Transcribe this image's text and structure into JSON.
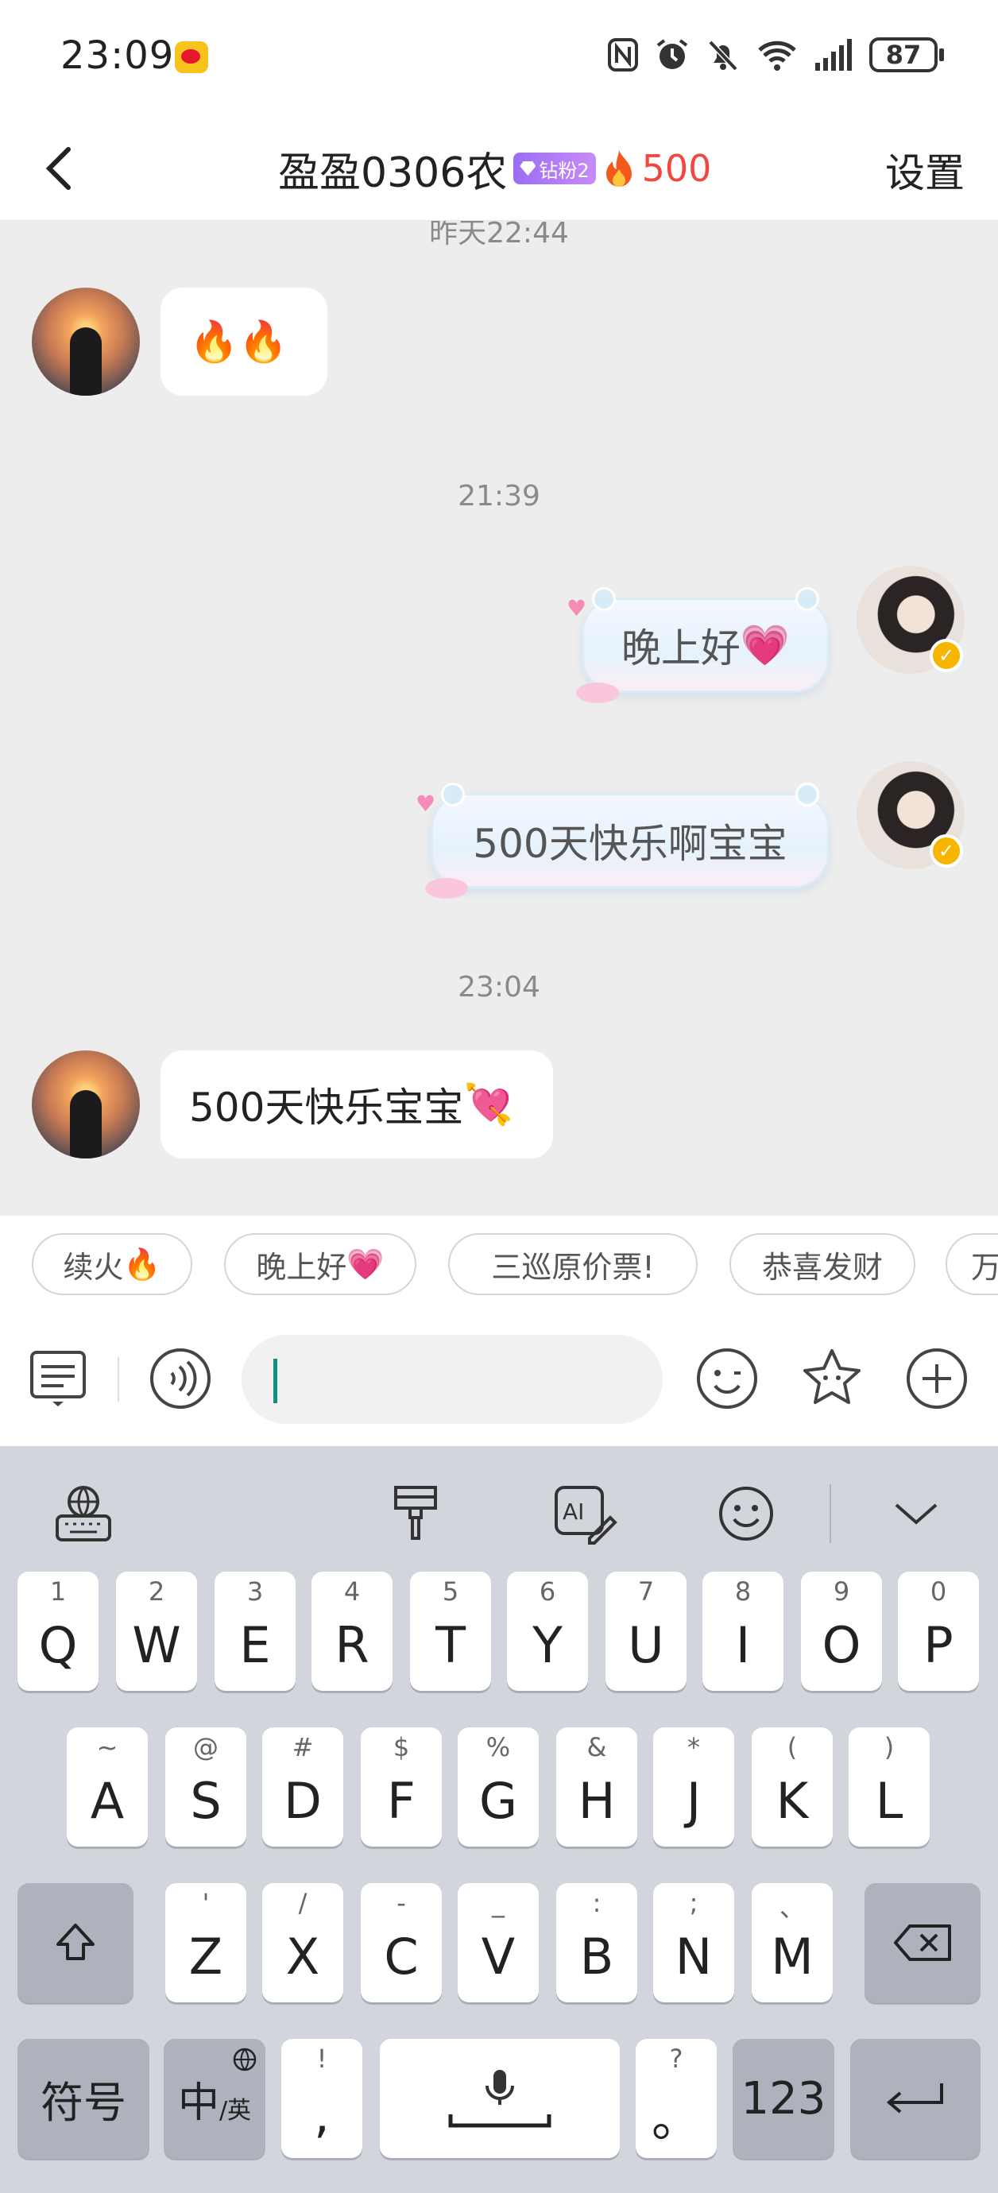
{
  "status_bar": {
    "time": "23:09",
    "battery": "87"
  },
  "header": {
    "title": "盈盈0306农",
    "fan_badge": "钻粉2",
    "streak": "500",
    "settings": "设置"
  },
  "chat": {
    "partial_time": "昨天22:44",
    "messages": [
      {
        "side": "in",
        "text": "🔥🔥"
      },
      {
        "time": "21:39"
      },
      {
        "side": "out",
        "text": "晚上好",
        "emoji": "💗"
      },
      {
        "side": "out",
        "text": "500天快乐啊宝宝"
      },
      {
        "time": "23:04"
      },
      {
        "side": "in",
        "text": "500天快乐宝宝",
        "emoji": "💘"
      }
    ]
  },
  "quick_replies": [
    {
      "label": "续火",
      "emoji": "🔥"
    },
    {
      "label": "晚上好",
      "emoji": "💗"
    },
    {
      "label": "三巡原价票!"
    },
    {
      "label": "恭喜发财"
    },
    {
      "label": "万"
    }
  ],
  "input": {
    "placeholder": ""
  },
  "keyboard": {
    "row1": [
      [
        "1",
        "Q"
      ],
      [
        "2",
        "W"
      ],
      [
        "3",
        "E"
      ],
      [
        "4",
        "R"
      ],
      [
        "5",
        "T"
      ],
      [
        "6",
        "Y"
      ],
      [
        "7",
        "U"
      ],
      [
        "8",
        "I"
      ],
      [
        "9",
        "O"
      ],
      [
        "0",
        "P"
      ]
    ],
    "row2": [
      [
        "~",
        "A"
      ],
      [
        "@",
        "S"
      ],
      [
        "#",
        "D"
      ],
      [
        "$",
        "F"
      ],
      [
        "%",
        "G"
      ],
      [
        "&",
        "H"
      ],
      [
        "*",
        "J"
      ],
      [
        "(",
        "K"
      ],
      [
        ")",
        "L"
      ]
    ],
    "row3": [
      [
        "'",
        "Z"
      ],
      [
        "/",
        "X"
      ],
      [
        "-",
        "C"
      ],
      [
        "_",
        "V"
      ],
      [
        ":",
        "B"
      ],
      [
        ";",
        "N"
      ],
      [
        "、",
        "M"
      ]
    ],
    "symbols": "符号",
    "lang_main": "中",
    "lang_sub": "/英",
    "comma_sub": "!",
    "comma": ",",
    "period_sub": "?",
    "period": "。",
    "numbers": "123"
  }
}
